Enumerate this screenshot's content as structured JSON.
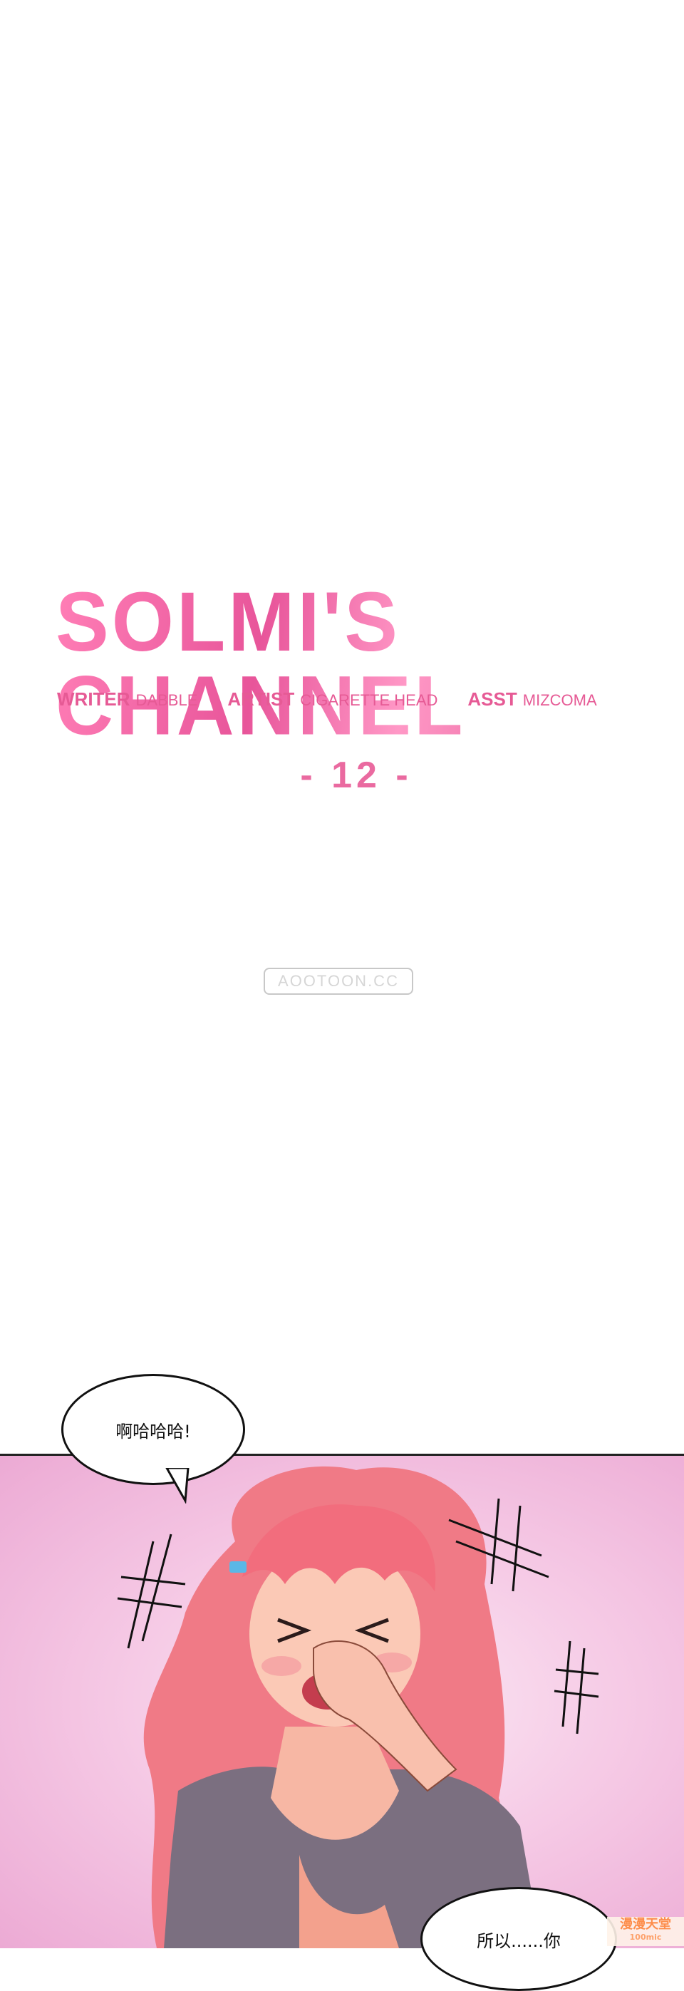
{
  "title": {
    "series_name": "SOLMI'S CHANNEL",
    "credits": [
      {
        "role": "Writer",
        "name": "Dabble"
      },
      {
        "role": "Artist",
        "name": "Cigarette head"
      },
      {
        "role": "ASST",
        "name": "Mizcoma"
      }
    ],
    "chapter": "- 12 -",
    "watermark": "AOOTOON.CC"
  },
  "panel": {
    "bubble_top": "啊哈哈哈!",
    "bubble_bottom": "所以......你",
    "corner_logo": "漫漫天堂",
    "corner_logo_sub": "100mic"
  },
  "colors": {
    "title_pink": "#ef5f9d",
    "panel_pink": "#ecaad4",
    "hair": "#f26d7d"
  }
}
